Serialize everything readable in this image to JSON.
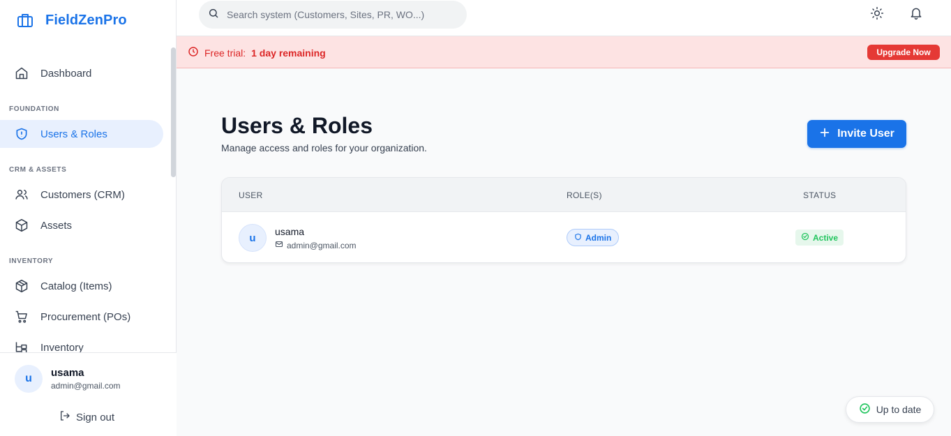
{
  "brand": {
    "name": "FieldZenPro"
  },
  "sidebar": {
    "items": [
      {
        "label": "Dashboard"
      },
      {
        "section": "FOUNDATION"
      },
      {
        "label": "Users & Roles"
      },
      {
        "section": "CRM & ASSETS"
      },
      {
        "label": "Customers (CRM)"
      },
      {
        "label": "Assets"
      },
      {
        "section": "INVENTORY"
      },
      {
        "label": "Catalog (Items)"
      },
      {
        "label": "Procurement (POs)"
      },
      {
        "label": "Inventory"
      }
    ],
    "user": {
      "initial": "u",
      "name": "usama",
      "email": "admin@gmail.com"
    },
    "signout_label": "Sign out"
  },
  "topbar": {
    "search_placeholder": "Search system (Customers, Sites, PR, WO...)"
  },
  "banner": {
    "prefix": "Free trial:",
    "remaining": "1 day remaining",
    "upgrade_label": "Upgrade Now"
  },
  "main": {
    "title": "Users & Roles",
    "subtitle": "Manage access and roles for your organization.",
    "invite_label": "Invite User",
    "table": {
      "headers": [
        "USER",
        "ROLE(S)",
        "STATUS"
      ],
      "rows": [
        {
          "initial": "u",
          "name": "usama",
          "email": "admin@gmail.com",
          "role": "Admin",
          "status": "Active"
        }
      ]
    }
  },
  "status_pill": {
    "label": "Up to date"
  },
  "colors": {
    "accent": "#1a73e8",
    "danger": "#e53935",
    "success": "#22c55e",
    "banner_bg": "#fde3e3"
  }
}
